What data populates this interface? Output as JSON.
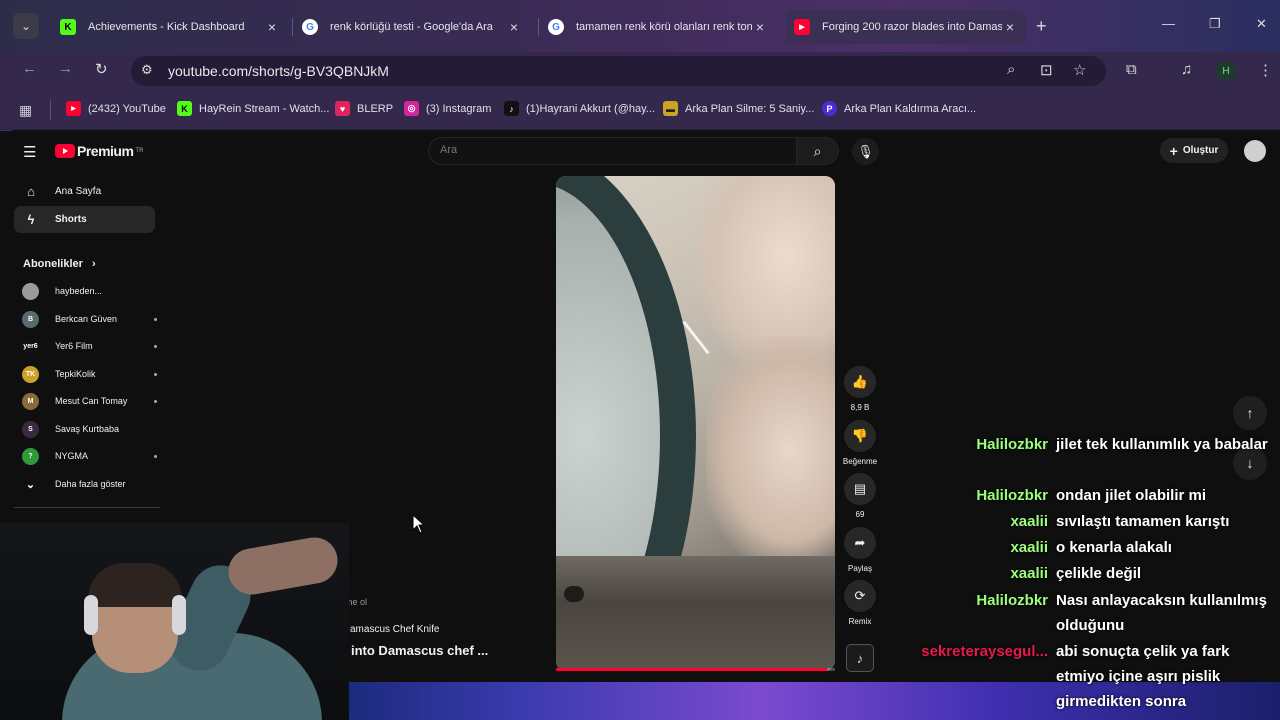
{
  "browser": {
    "tabs": [
      {
        "title": "Achievements - Kick Dashboard",
        "icon": "kick-icon",
        "color": "#53fc18",
        "glyph": "K"
      },
      {
        "title": "renk körlüğü testi - Google'da Ara",
        "icon": "google-icon",
        "color": "#ffffff",
        "glyph": "G"
      },
      {
        "title": "tamamen renk körü olanları renk tonu",
        "icon": "google-icon",
        "color": "#ffffff",
        "glyph": "G"
      },
      {
        "title": "Forging 200 razor blades into Damasc",
        "icon": "youtube-icon",
        "color": "#ff0033",
        "glyph": "▶"
      }
    ],
    "active_tab": 3,
    "url": "youtube.com/shorts/g-BV3QBNJkM",
    "profile_initial": "H",
    "bookmarks": [
      {
        "label": "(2432) YouTube",
        "icon": "youtube-icon",
        "color": "#ff0033",
        "glyph": "▶"
      },
      {
        "label": "HayRein Stream - Watch...",
        "icon": "kick-icon",
        "color": "#53fc18",
        "glyph": "K"
      },
      {
        "label": "BLERP",
        "icon": "blerp-icon",
        "color": "#e0245e",
        "glyph": "♥"
      },
      {
        "label": "(3) Instagram",
        "icon": "instagram-icon",
        "color": "#d6249f",
        "glyph": "◎"
      },
      {
        "label": "(1)Hayrani Akkurt (@hay...",
        "icon": "tiktok-icon",
        "color": "#111111",
        "glyph": "♪"
      },
      {
        "label": "Arka Plan Silme: 5 Saniy...",
        "icon": "removebg-icon",
        "color": "#c9a227",
        "glyph": "▬"
      },
      {
        "label": "Arka Plan Kaldırma Aracı...",
        "icon": "picsart-icon",
        "color": "#4b2bd6",
        "glyph": "P"
      }
    ]
  },
  "youtube": {
    "logo_text": "Premium",
    "logo_sup": "TR",
    "search_placeholder": "Ara",
    "create_label": "Oluştur",
    "nav": [
      {
        "label": "Ana Sayfa",
        "icon": "home-icon",
        "glyph": "⌂"
      },
      {
        "label": "Shorts",
        "icon": "shorts-icon",
        "glyph": "ϟ"
      }
    ],
    "subscriptions_header": "Abonelikler",
    "subscriptions": [
      {
        "name": "haybeden...",
        "color": "#9a9a9a",
        "glyph": "",
        "dot": false
      },
      {
        "name": "Berkcan Güven",
        "color": "#5c6a70",
        "glyph": "B",
        "dot": true
      },
      {
        "name": "Yer6 Film",
        "color": "#111111",
        "glyph": "yer6",
        "dot": true
      },
      {
        "name": "TepkiKolik",
        "color": "#c9a227",
        "glyph": "TK",
        "dot": true
      },
      {
        "name": "Mesut Can Tomay",
        "color": "#8a6a3a",
        "glyph": "M",
        "dot": true
      },
      {
        "name": "Savaş Kurtbaba",
        "color": "#3a2a40",
        "glyph": "S",
        "dot": false
      },
      {
        "name": "NYGMA",
        "color": "#2f9a3a",
        "glyph": "?",
        "dot": true
      }
    ],
    "show_more": "Daha fazla göster",
    "short": {
      "subscribe_hint": "me ol",
      "audio": "amascus Chef Knife",
      "title": "into Damascus chef ...",
      "progress": 0.97
    },
    "actions": [
      {
        "label": "8,9 B",
        "icon": "like-icon",
        "glyph": "👍"
      },
      {
        "label": "Beğenme",
        "icon": "dislike-icon",
        "glyph": "👎"
      },
      {
        "label": "69",
        "icon": "comment-icon",
        "glyph": "▤"
      },
      {
        "label": "Paylaş",
        "icon": "share-icon",
        "glyph": "➦"
      },
      {
        "label": "Remix",
        "icon": "remix-icon",
        "glyph": "⟳"
      }
    ]
  },
  "chat": [
    {
      "user": "Halilozbkr",
      "color": "#9cff7a",
      "text": "jilet tek kullanımlık ya babalar"
    },
    {
      "user": "Halilozbkr",
      "color": "#9cff7a",
      "text": "ondan jilet olabilir mi"
    },
    {
      "user": "xaalii",
      "color": "#9cff7a",
      "text": "sıvılaştı tamamen karıştı"
    },
    {
      "user": "xaalii",
      "color": "#9cff7a",
      "text": "o kenarla alakalı"
    },
    {
      "user": "xaalii",
      "color": "#9cff7a",
      "text": "çelikle değil"
    },
    {
      "user": "Halilozbkr",
      "color": "#9cff7a",
      "text": "Nası anlayacaksın kullanılmış olduğunu"
    },
    {
      "user": "sekreteraysegul...",
      "color": "#e8194b",
      "text": "abi sonuçta çelik ya fark etmiyo içine aşırı pislik girmedikten sonra"
    }
  ]
}
